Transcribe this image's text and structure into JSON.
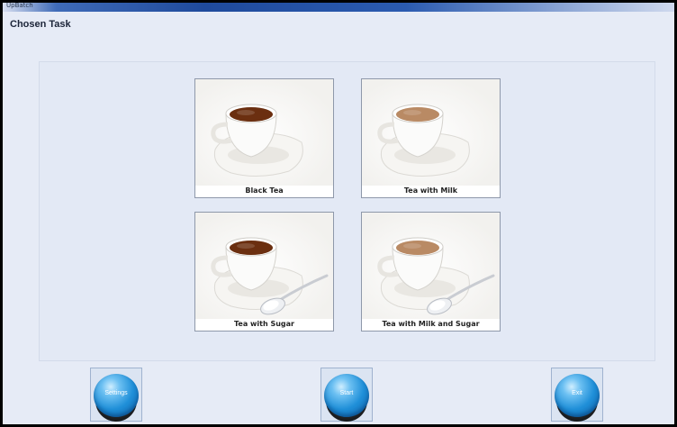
{
  "window": {
    "app_name": "UpBatch"
  },
  "header": {
    "title": "Chosen Task"
  },
  "tasks": [
    {
      "label": "Black Tea",
      "tea": "black",
      "spoon": false
    },
    {
      "label": "Tea with Milk",
      "tea": "milk",
      "spoon": false
    },
    {
      "label": "Tea with Sugar",
      "tea": "black",
      "spoon": true
    },
    {
      "label": "Tea with Milk and Sugar",
      "tea": "milk",
      "spoon": true
    }
  ],
  "buttons": {
    "settings": "Settings",
    "start": "Start",
    "exit": "Exit"
  },
  "colors": {
    "black_tea": "#6b2f10",
    "milk_tea": "#b98a64",
    "button_blue": "#1f8fd8"
  }
}
